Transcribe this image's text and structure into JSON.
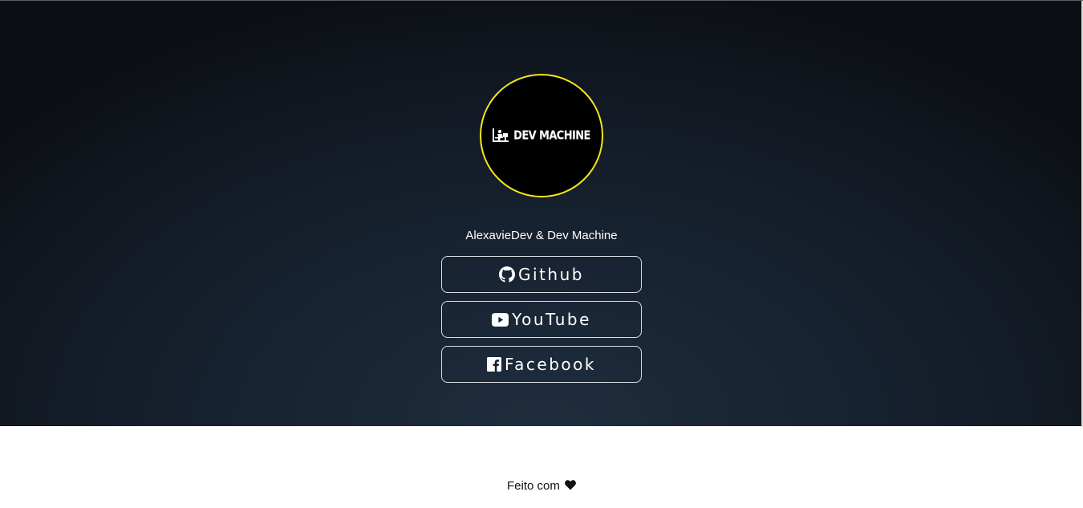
{
  "profile": {
    "avatar_text": "DEV MACHINE",
    "avatar_icon": "developer-desk-icon",
    "owner": "AlexavieDev & Dev Machine",
    "accent_color": "#f2e61d"
  },
  "links": [
    {
      "label": "Github",
      "icon": "github-icon"
    },
    {
      "label": "YouTube",
      "icon": "youtube-icon"
    },
    {
      "label": "Facebook",
      "icon": "facebook-icon"
    }
  ],
  "footer": {
    "text": "Feito com",
    "icon": "heart-icon"
  }
}
